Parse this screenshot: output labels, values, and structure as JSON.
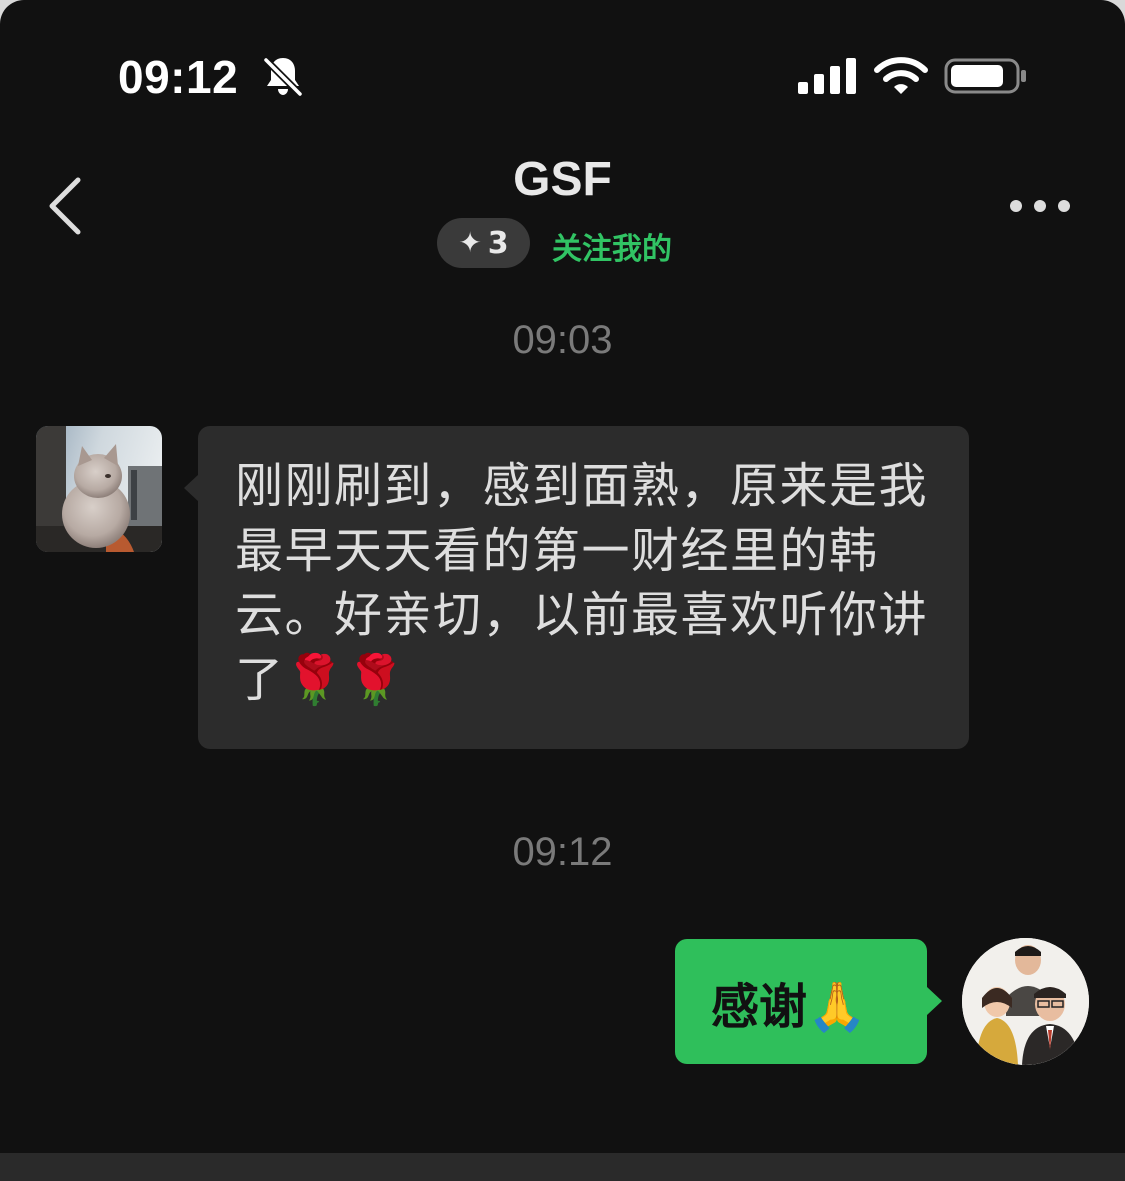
{
  "status_bar": {
    "time": "09:12",
    "icons": [
      "bell-muted-icon",
      "cellular-signal-icon",
      "wifi-icon",
      "battery-icon"
    ]
  },
  "header": {
    "title": "GSF",
    "badge": {
      "icon": "sparkle-icon",
      "glyph": "✦",
      "count": "3"
    },
    "follow_status": "关注我的",
    "left_icon": "back-chevron-icon",
    "right_icon": "more-icon"
  },
  "messages": [
    {
      "timestamp": "09:03",
      "direction": "incoming",
      "avatar": "cat-photo-avatar",
      "text": "刚刚刷到，感到面熟，原来是我最早天天看的第一财经里的韩云。好亲切，以前最喜欢听你讲了🌹🌹"
    },
    {
      "timestamp": "09:12",
      "direction": "outgoing",
      "avatar": "group-photo-avatar",
      "text": "感谢🙏"
    }
  ],
  "colors": {
    "background": "#111111",
    "incoming_bubble": "#2c2c2c",
    "outgoing_bubble": "#2fbf5b",
    "follow_green": "#31c464",
    "timestamp_gray": "#7a7a7a"
  }
}
